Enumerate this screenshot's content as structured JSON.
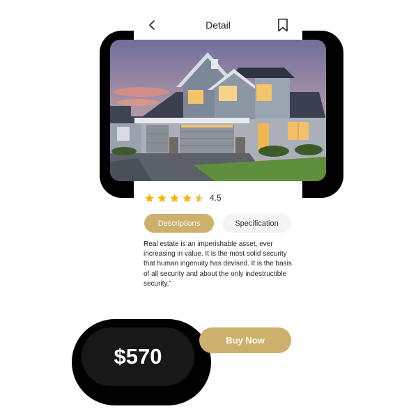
{
  "header": {
    "back_icon": "chevron-left-icon",
    "title": "Detail",
    "bookmark_icon": "bookmark-icon"
  },
  "hero_image": {
    "subject": "house"
  },
  "rating": {
    "stars": 4.5,
    "max_stars": 5,
    "value_label": "4.5",
    "star_color": "#f5b400"
  },
  "tabs": [
    {
      "label": "Descriptions",
      "active": true
    },
    {
      "label": "Specification",
      "active": false
    }
  ],
  "description": "Real estate is an imperishable asset, ever increasing in value. It is the most solid security that human ingenuity has devised. It is the basis of all security and about the only indestructible security.”",
  "price": "$570",
  "buy_button": {
    "label": "Buy Now"
  },
  "colors": {
    "accent": "#cdb06b",
    "dark": "#181818",
    "star": "#f5b400"
  }
}
